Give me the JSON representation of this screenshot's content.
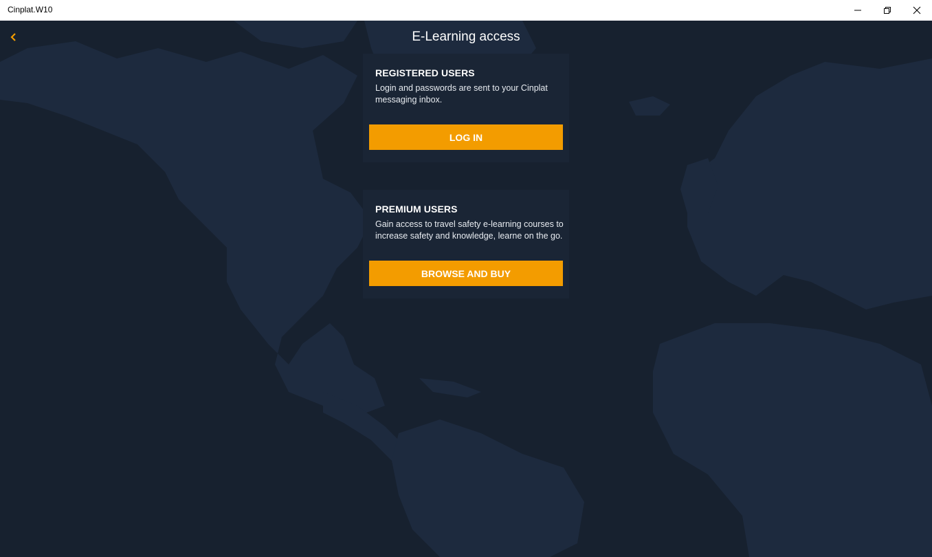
{
  "window": {
    "title": "Cinplat.W10",
    "controls": [
      "minimize-icon",
      "restore-icon",
      "close-icon"
    ]
  },
  "header": {
    "back_icon": "chevron-left-icon",
    "title": "E-Learning access"
  },
  "cards": [
    {
      "heading": "REGISTERED USERS",
      "text": "Login and passwords are sent to your Cinplat messaging inbox.",
      "button": "LOG IN"
    },
    {
      "heading": "PREMIUM USERS",
      "text": "Gain access to travel safety e-learning courses to increase safety and knowledge, learne on the go.",
      "button": "BROWSE AND BUY"
    }
  ],
  "colors": {
    "background": "#17212f",
    "landmass": "#1d2a3e",
    "card": "#1a2535",
    "accent": "#f39c00",
    "text": "#ffffff"
  }
}
